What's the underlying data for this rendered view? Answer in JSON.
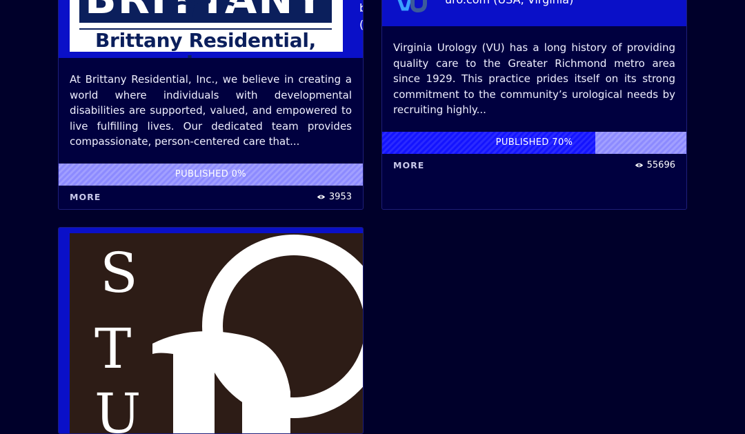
{
  "cards": [
    {
      "logo_line1": "BRITTANY",
      "logo_line2": "Brittany Residential, Inc.",
      "side_text_1": "b",
      "side_text_2": "(",
      "description": "At Brittany Residential, Inc., we believe in creating a world where individuals with developmental disabilities are supported, valued, and empowered to live fulfilling lives. Our dedicated team provides compassionate, person-centered care that...",
      "published_label": "PUBLISHED 0%",
      "published_fraction": 0.0,
      "more_label": "MORE",
      "views": "3953"
    },
    {
      "header_text": "uro.com (USA, Virginia)",
      "description": "Virginia Urology (VU) has a long history of providing quality care to the Greater Richmond metro area since 1929. This practice prides itself on its strong commitment to the community’s urological needs by recruiting highly...",
      "published_label": "PUBLISHED 70%",
      "published_fraction": 0.7,
      "more_label": "MORE",
      "views": "55696"
    },
    {
      "logo_letters": [
        "S",
        "T",
        "U"
      ]
    }
  ],
  "colors": {
    "page_bg": "#00002a",
    "card_bg": "#00003f",
    "card_header_bg": "#0a10c8",
    "progress_track": "#8d8bff",
    "progress_fill": "#1414ff",
    "logo_navy": "#0b1f5c",
    "logo3_bg": "#2d1c16"
  }
}
